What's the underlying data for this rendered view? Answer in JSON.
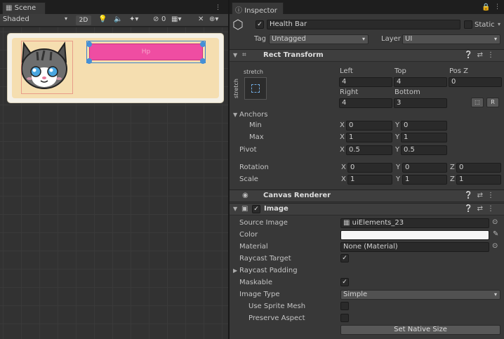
{
  "scene": {
    "tab_label": "Scene",
    "shading_mode": "Shaded",
    "mode_2d": "2D",
    "gizmo_count": "0",
    "health_bar_label": "Hp"
  },
  "inspector": {
    "tab_label": "Inspector",
    "object_name": "Health Bar",
    "static_label": "Static",
    "tag_label": "Tag",
    "tag_value": "Untagged",
    "layer_label": "Layer",
    "layer_value": "UI",
    "rect_transform": {
      "title": "Rect Transform",
      "anchor_preset_label": "stretch",
      "anchor_preset_side_label": "stretch",
      "left_label": "Left",
      "left": "4",
      "top_label": "Top",
      "top": "4",
      "posz_label": "Pos Z",
      "posz": "0",
      "right_label": "Right",
      "right": "4",
      "bottom_label": "Bottom",
      "bottom": "3",
      "anchors_label": "Anchors",
      "min_label": "Min",
      "min_x": "0",
      "min_y": "0",
      "max_label": "Max",
      "max_x": "1",
      "max_y": "1",
      "pivot_label": "Pivot",
      "pivot_x": "0.5",
      "pivot_y": "0.5",
      "rotation_label": "Rotation",
      "rot_x": "0",
      "rot_y": "0",
      "rot_z": "0",
      "scale_label": "Scale",
      "scale_x": "1",
      "scale_y": "1",
      "scale_z": "1",
      "x": "X",
      "y": "Y",
      "z": "Z"
    },
    "canvas_renderer": {
      "title": "Canvas Renderer"
    },
    "image": {
      "title": "Image",
      "source_image_label": "Source Image",
      "source_image": "uiElements_23",
      "color_label": "Color",
      "color": "#f5f5f5",
      "material_label": "Material",
      "material": "None (Material)",
      "raycast_target_label": "Raycast Target",
      "raycast_padding_label": "Raycast Padding",
      "maskable_label": "Maskable",
      "image_type_label": "Image Type",
      "image_type": "Simple",
      "use_sprite_mesh_label": "Use Sprite Mesh",
      "preserve_aspect_label": "Preserve Aspect",
      "set_native_size_label": "Set Native Size"
    }
  }
}
